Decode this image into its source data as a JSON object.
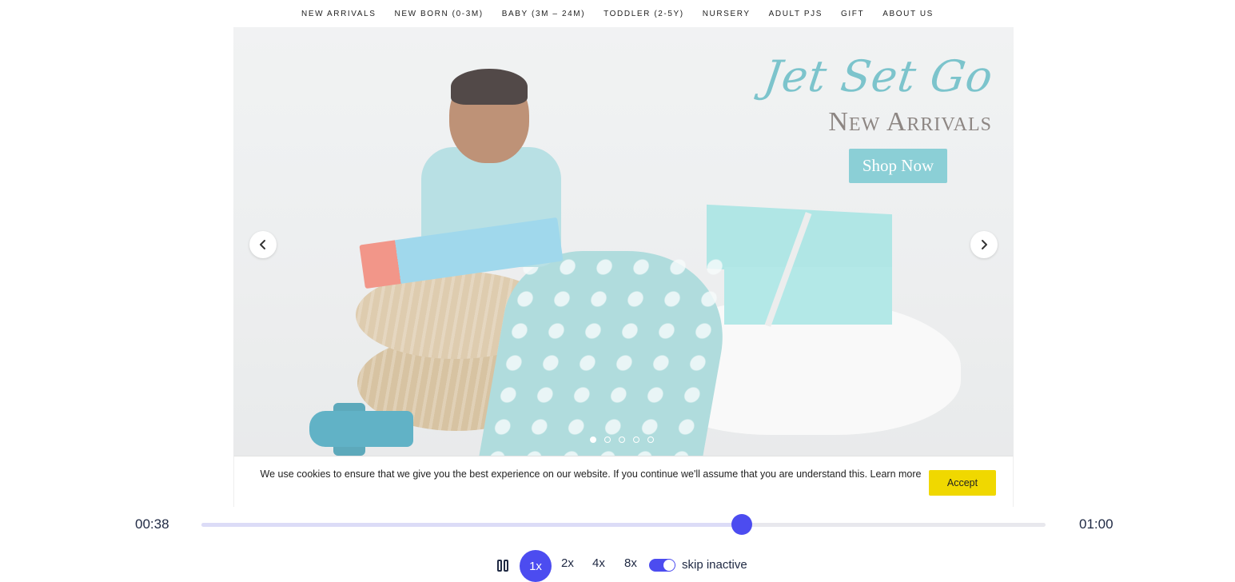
{
  "nav": {
    "items": [
      "NEW ARRIVALS",
      "NEW BORN (0-3M)",
      "BABY (3M – 24M)",
      "TODDLER (2-5Y)",
      "NURSERY",
      "ADULT PJS",
      "GIFT",
      "ABOUT US"
    ]
  },
  "hero": {
    "title": "Jet Set Go",
    "subtitle": "New Arrivals",
    "cta_label": "Shop Now",
    "slide_count": 5,
    "active_slide": 1,
    "prev_icon": "chevron-left-icon",
    "next_icon": "chevron-right-icon"
  },
  "cookie": {
    "message": "We use cookies to ensure that we give you the best experience on our website. If you continue we'll assume that you are understand this.",
    "learn_more": "Learn more",
    "accept_label": "Accept"
  },
  "player": {
    "current_time": "00:38",
    "total_time": "01:00",
    "progress": 0.64,
    "pause_icon": "pause-icon",
    "speeds": [
      "1x",
      "2x",
      "4x",
      "8x"
    ],
    "active_speed": "1x",
    "skip_inactive_label": "skip inactive",
    "skip_inactive_on": true
  },
  "colors": {
    "accent": "#4c4cf0",
    "accept": "#f0d800",
    "shop_button": "#8bcfd6",
    "hero_title": "#7cc4cc",
    "hero_subtitle": "#8d8683"
  }
}
